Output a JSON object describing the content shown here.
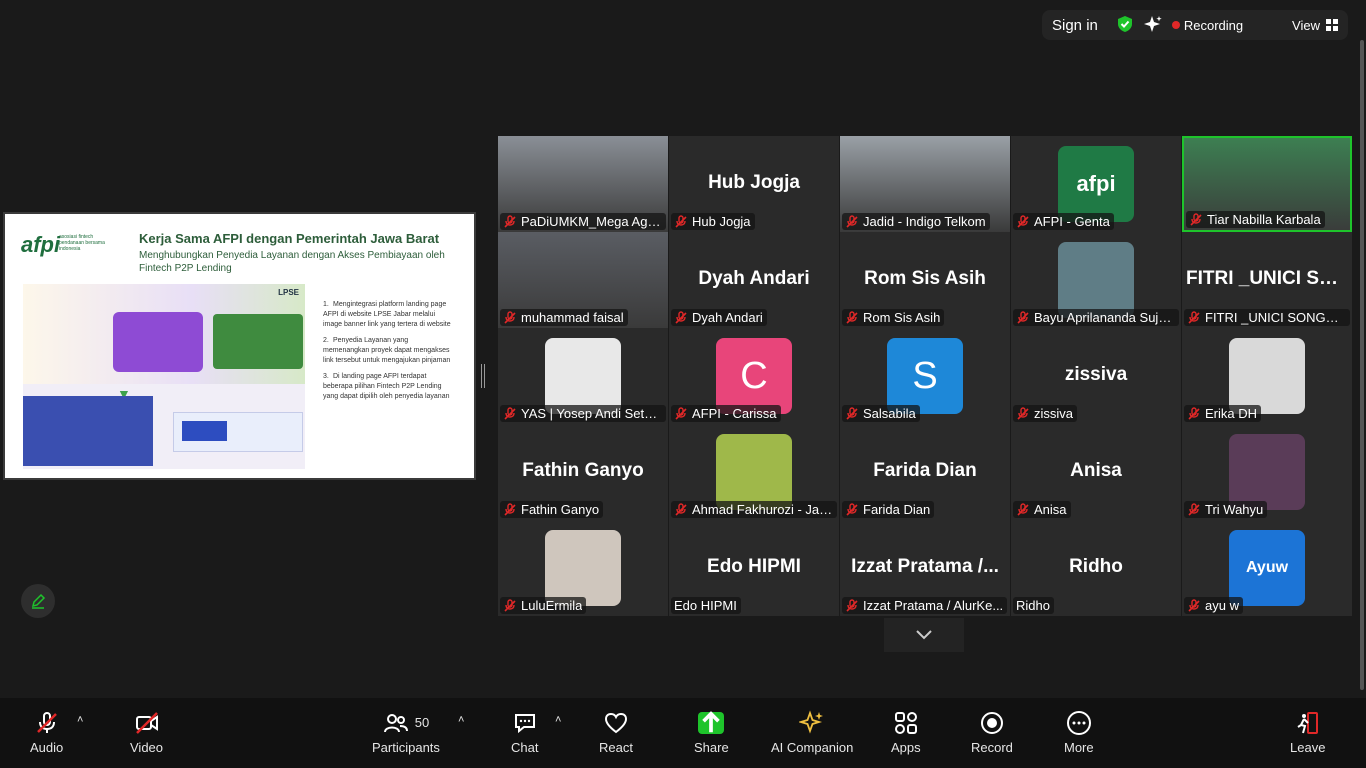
{
  "topbar": {
    "sign_in": "Sign in",
    "recording": "Recording",
    "view": "View"
  },
  "slide": {
    "logo_text": "afpi",
    "logo_sub": "asosiasi fintech pendanaan bersama indonesia",
    "title": "Kerja Sama AFPI dengan Pemerintah Jawa Barat",
    "subtitle": "Menghubungkan Penyedia Layanan dengan Akses Pembiayaan oleh Fintech P2P Lending",
    "banner_lpse": "LPSE",
    "list": [
      {
        "n": "1.",
        "text": "Mengintegrasi platform landing page AFPI di website LPSE Jabar melalui image banner link yang tertera di website"
      },
      {
        "n": "2.",
        "text": "Penyedia Layanan yang memenangkan proyek dapat mengakses link tersebut untuk mengajukan pinjaman"
      },
      {
        "n": "3.",
        "text": "Di landing page AFPI terdapat beberapa pilihan Fintech P2P Lending yang dapat dipilih oleh penyedia layanan"
      }
    ]
  },
  "tiles": [
    {
      "name": "PaDiUMKM_Mega Agu...",
      "big": "",
      "kind": "photo",
      "color": "#8a8f96"
    },
    {
      "name": "Hub Jogja",
      "big": "Hub Jogja",
      "kind": "text"
    },
    {
      "name": "Jadid - Indigo Telkom",
      "big": "",
      "kind": "photo",
      "color": "#9aa0a6"
    },
    {
      "name": "AFPI - Genta",
      "big": "",
      "kind": "logo",
      "color": "#1f7a45",
      "letter": "afpi"
    },
    {
      "name": "Tiar Nabilla Karbala",
      "big": "",
      "kind": "photo",
      "color": "#3d7f52",
      "active": true
    },
    {
      "name": "muhammad faisal",
      "big": "",
      "kind": "photo",
      "color": "#5a5d63"
    },
    {
      "name": "Dyah Andari",
      "big": "Dyah Andari",
      "kind": "text"
    },
    {
      "name": "Rom Sis Asih",
      "big": "Rom Sis Asih",
      "kind": "text"
    },
    {
      "name": "Bayu Aprilananda Suja...",
      "big": "",
      "kind": "avatar",
      "color": "#5f7d86",
      "letter": ""
    },
    {
      "name": "FITRI _UNICI SONGKET",
      "big": "FITRI _UNICI SO...",
      "kind": "text"
    },
    {
      "name": "YAS | Yosep Andi Setya...",
      "big": "",
      "kind": "avatar",
      "color": "#e8e8e8",
      "letter": ""
    },
    {
      "name": "AFPI - Carissa",
      "big": "",
      "kind": "avatar",
      "color": "#e8457a",
      "letter": "C"
    },
    {
      "name": "Salsabila",
      "big": "",
      "kind": "avatar",
      "color": "#1e88d8",
      "letter": "S"
    },
    {
      "name": "zissiva",
      "big": "zissiva",
      "kind": "text"
    },
    {
      "name": "Erika DH",
      "big": "",
      "kind": "avatar",
      "color": "#d9d9d9",
      "letter": ""
    },
    {
      "name": "Fathin Ganyo",
      "big": "Fathin Ganyo",
      "kind": "text"
    },
    {
      "name": "Ahmad Fakhurozi - Jav...",
      "big": "",
      "kind": "avatar",
      "color": "#9fb84a",
      "letter": ""
    },
    {
      "name": "Farida Dian",
      "big": "Farida Dian",
      "kind": "text"
    },
    {
      "name": "Anisa",
      "big": "Anisa",
      "kind": "text"
    },
    {
      "name": "Tri Wahyu",
      "big": "",
      "kind": "avatar",
      "color": "#5a3c58",
      "letter": ""
    },
    {
      "name": "LuluErmila",
      "big": "",
      "kind": "avatar",
      "color": "#cfc6bd",
      "letter": ""
    },
    {
      "name": "Edo HIPMI",
      "big": "Edo HIPMI",
      "kind": "text",
      "nomic": true
    },
    {
      "name": "Izzat Pratama / AlurKe...",
      "big": "Izzat Pratama /...",
      "kind": "text"
    },
    {
      "name": "Ridho",
      "big": "Ridho",
      "kind": "text",
      "nomic": true
    },
    {
      "name": "ayu w",
      "big": "",
      "kind": "avatar",
      "color": "#1c74d6",
      "letter": "Ayuw"
    }
  ],
  "toolbar": {
    "audio": "Audio",
    "video": "Video",
    "participants": "Participants",
    "participants_count": "50",
    "chat": "Chat",
    "react": "React",
    "share": "Share",
    "ai_companion": "AI Companion",
    "apps": "Apps",
    "record": "Record",
    "more": "More",
    "leave": "Leave"
  },
  "colors": {
    "accent_green": "#1ec42b",
    "muted_red": "#e02828"
  }
}
